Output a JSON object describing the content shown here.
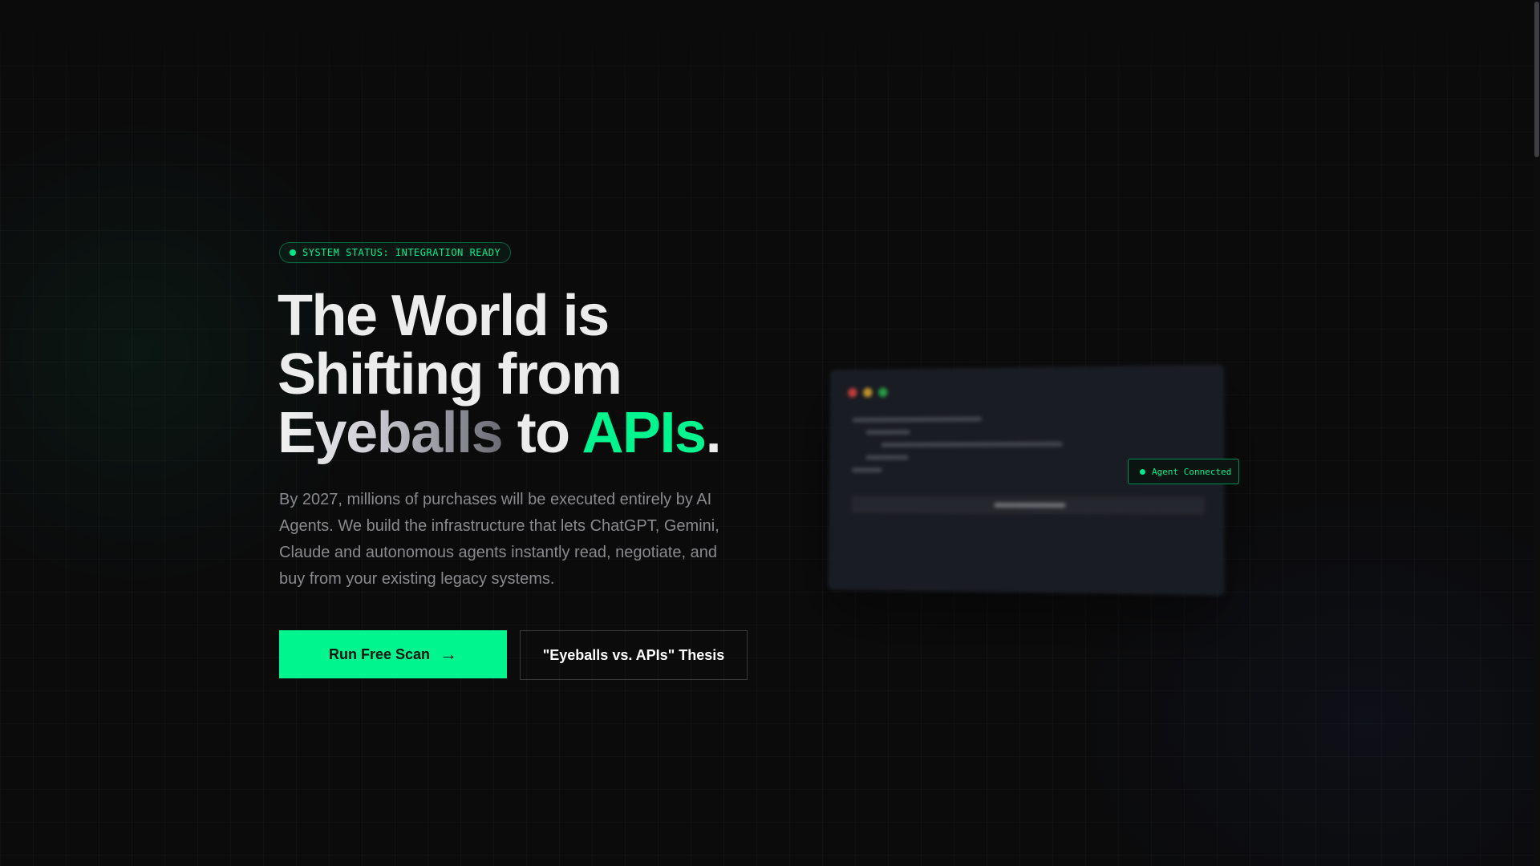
{
  "hero": {
    "status": "SYSTEM STATUS: INTEGRATION READY",
    "headline": {
      "line1": "The World is",
      "line2": "Shifting from",
      "word_eyeballs": "Eyeballs",
      "word_to": " to ",
      "word_apis": "APIs",
      "period": "."
    },
    "lead": "By 2027, millions of purchases will be executed entirely by AI Agents. We build the infrastructure that lets ChatGPT, Gemini, Claude and autonomous agents instantly read, negotiate, and buy from your existing legacy systems.",
    "primary_button": "Run Free Scan",
    "primary_button_icon": "→",
    "secondary_button": "\"Eyeballs vs. APIs\" Thesis"
  },
  "terminal": {
    "badge": "Agent Connected"
  },
  "colors": {
    "accent": "#00f58f",
    "background": "#0b0b0c",
    "text": "#ececec",
    "muted": "#8a8a8e"
  }
}
